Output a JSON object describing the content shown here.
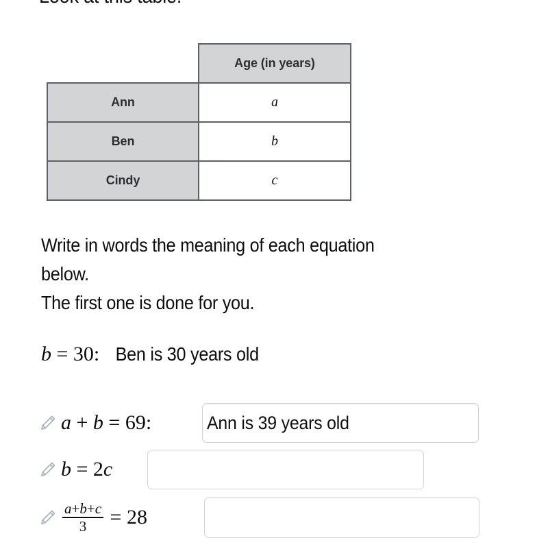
{
  "heading": {
    "text": "Look at this table."
  },
  "table": {
    "corner_cell": "",
    "header": "Age (in years)",
    "rows": [
      {
        "name": "Ann",
        "value": "a"
      },
      {
        "name": "Ben",
        "value": "b"
      },
      {
        "name": "Cindy",
        "value": "c"
      }
    ]
  },
  "instructions": {
    "line1": "Write in words the meaning of each equation",
    "line2": "below.",
    "line3": "The first one is done for you."
  },
  "example": {
    "equation_var": "b",
    "equation_op": "=",
    "equation_num": "30",
    "equation_colon": ":",
    "answer": "Ben is 30 years old"
  },
  "answers": [
    {
      "icon": "pencil-icon",
      "eq_lhs_a": "a",
      "eq_plus": "+",
      "eq_lhs_b": "b",
      "eq_equals": "=",
      "eq_rhs": "69",
      "eq_colon": ":",
      "value": "Ann is 39 years old",
      "placeholder": ""
    },
    {
      "icon": "pencil-icon",
      "eq_lhs_b": "b",
      "eq_equals": "=",
      "eq_rhs_num": "2",
      "eq_rhs_var": "c",
      "value": "",
      "placeholder": ""
    },
    {
      "icon": "pencil-icon",
      "numerator_a": "a",
      "numerator_plus1": "+",
      "numerator_b": "b",
      "numerator_plus2": "+",
      "numerator_c": "c",
      "denominator": "3",
      "eq_equals": "=",
      "eq_rhs": "28",
      "value": "",
      "placeholder": ""
    }
  ],
  "colors": {
    "table_border": "#5c5f63",
    "table_header_fill": "#d2d4d6",
    "pencil": "#a9b3bd",
    "input_border": "#d4d4d4",
    "text": "#0d0d0d"
  }
}
